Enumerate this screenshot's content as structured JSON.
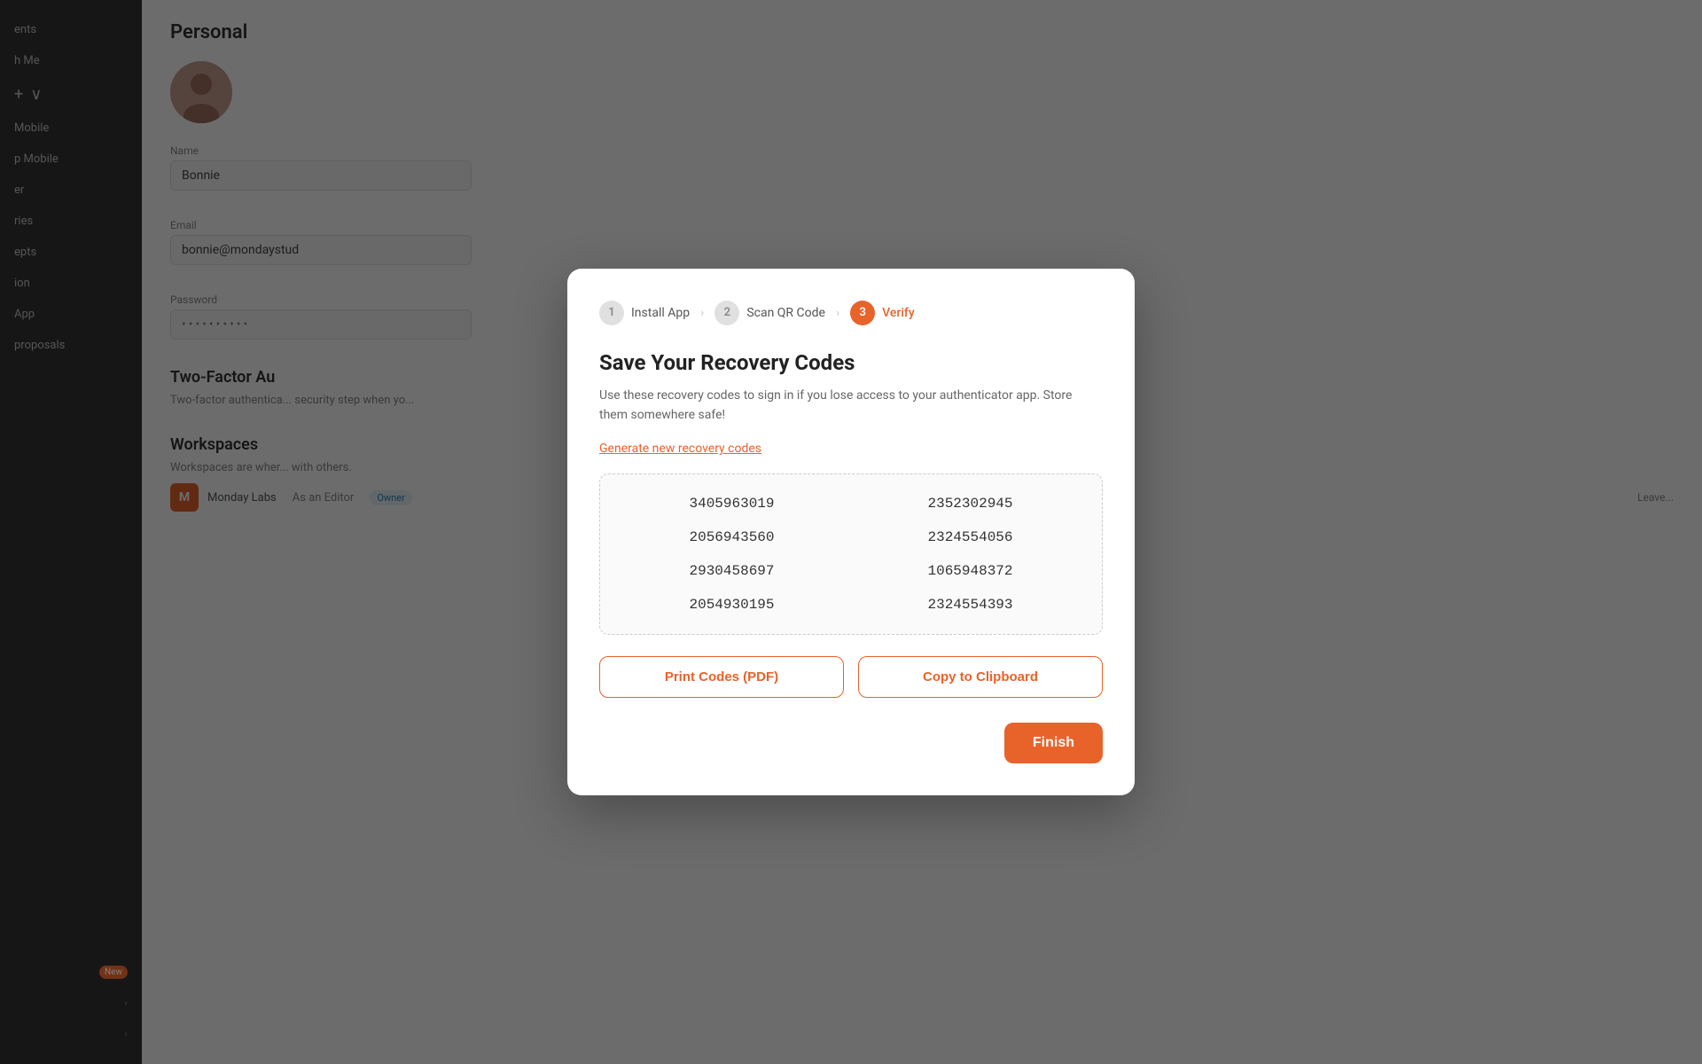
{
  "sidebar": {
    "items": [
      {
        "label": "ents",
        "badge": null
      },
      {
        "label": "h Me",
        "badge": null
      },
      {
        "label": "ries",
        "badge": null
      },
      {
        "label": "epts",
        "badge": null
      },
      {
        "label": "ion",
        "badge": null
      },
      {
        "label": "App",
        "badge": null
      },
      {
        "label": "proposals",
        "badge": null
      }
    ],
    "new_badge": "New",
    "workspace_chevron": "›"
  },
  "background": {
    "section_personal": "Personal",
    "field_name_label": "Name",
    "field_name_value": "Bonnie",
    "field_email_label": "Email",
    "field_email_value": "bonnie@mondaystud",
    "field_password_label": "Password",
    "field_password_value": "••••••••••",
    "section_two_factor": "Two-Factor Au",
    "two_factor_desc": "Two-factor authentica... security step when yo...",
    "section_workspaces": "Workspaces",
    "workspaces_desc": "Workspaces are wher... with others.",
    "workspace_name": "Monday Labs",
    "workspace_role": "As an Editor",
    "workspace_badge": "Owner",
    "workspace_action": "Leave..."
  },
  "modal": {
    "stepper": {
      "step1_num": "1",
      "step1_label": "Install App",
      "step2_num": "2",
      "step2_label": "Scan QR Code",
      "step3_num": "3",
      "step3_label": "Verify"
    },
    "title": "Save Your Recovery Codes",
    "description": "Use these recovery codes to sign in if you lose access to your authenticator app. Store them somewhere safe!",
    "generate_link": "Generate new recovery codes",
    "codes": [
      "3405963019",
      "2352302945",
      "2056943560",
      "2324554056",
      "2930458697",
      "1065948372",
      "20549301 95",
      "2324554393"
    ],
    "btn_print": "Print Codes (PDF)",
    "btn_copy": "Copy to Clipboard",
    "btn_finish": "Finish"
  }
}
